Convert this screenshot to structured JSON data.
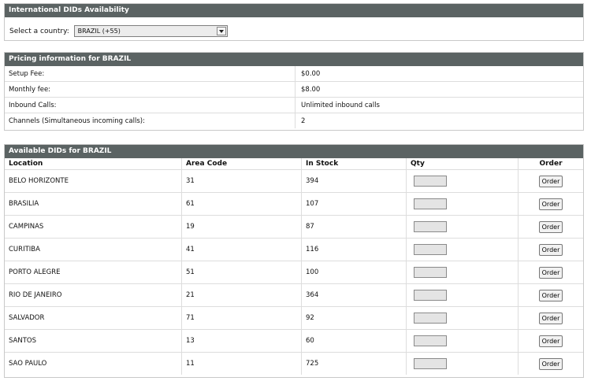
{
  "country_section": {
    "title": "International DIDs Availability",
    "select_label": "Select a country:",
    "selected_country": "BRAZIL (+55)"
  },
  "pricing_section": {
    "title": "Pricing information for BRAZIL",
    "rows": [
      {
        "label": "Setup Fee:",
        "value": "$0.00"
      },
      {
        "label": "Monthly fee:",
        "value": "$8.00"
      },
      {
        "label": "Inbound Calls:",
        "value": "Unlimited inbound calls"
      },
      {
        "label": "Channels (Simultaneous incoming calls):",
        "value": "2"
      }
    ]
  },
  "dids_section": {
    "title": "Available DIDs for BRAZIL",
    "columns": {
      "location": "Location",
      "area_code": "Area Code",
      "in_stock": "In Stock",
      "qty": "Qty",
      "order": "Order"
    },
    "order_button_label": "Order",
    "rows": [
      {
        "location": "BELO HORIZONTE",
        "area_code": "31",
        "in_stock": "394",
        "qty": ""
      },
      {
        "location": "BRASILIA",
        "area_code": "61",
        "in_stock": "107",
        "qty": ""
      },
      {
        "location": "CAMPINAS",
        "area_code": "19",
        "in_stock": "87",
        "qty": ""
      },
      {
        "location": "CURITIBA",
        "area_code": "41",
        "in_stock": "116",
        "qty": ""
      },
      {
        "location": "PORTO ALEGRE",
        "area_code": "51",
        "in_stock": "100",
        "qty": ""
      },
      {
        "location": "RIO DE JANEIRO",
        "area_code": "21",
        "in_stock": "364",
        "qty": ""
      },
      {
        "location": "SALVADOR",
        "area_code": "71",
        "in_stock": "92",
        "qty": ""
      },
      {
        "location": "SANTOS",
        "area_code": "13",
        "in_stock": "60",
        "qty": ""
      },
      {
        "location": "SAO PAULO",
        "area_code": "11",
        "in_stock": "725",
        "qty": ""
      }
    ]
  },
  "colors": {
    "header_bg": "#5b6363",
    "header_text": "#ffffff",
    "border": "#c9c9c9"
  }
}
